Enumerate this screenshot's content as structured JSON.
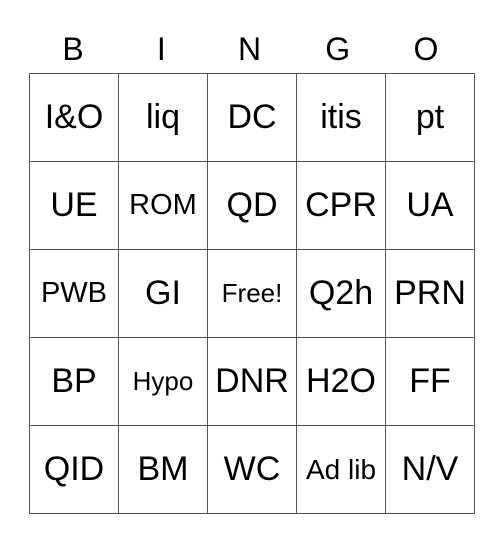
{
  "header": [
    "B",
    "I",
    "N",
    "G",
    "O"
  ],
  "rows": [
    [
      {
        "t": "I&O",
        "s": "s1"
      },
      {
        "t": "liq",
        "s": "s1"
      },
      {
        "t": "DC",
        "s": "s1"
      },
      {
        "t": "itis",
        "s": "s1"
      },
      {
        "t": "pt",
        "s": "s1"
      }
    ],
    [
      {
        "t": "UE",
        "s": "s1"
      },
      {
        "t": "ROM",
        "s": "s2"
      },
      {
        "t": "QD",
        "s": "s1"
      },
      {
        "t": "CPR",
        "s": "s1"
      },
      {
        "t": "UA",
        "s": "s1"
      }
    ],
    [
      {
        "t": "PWB",
        "s": "s2"
      },
      {
        "t": "GI",
        "s": "s1"
      },
      {
        "t": "Free!",
        "s": "s3"
      },
      {
        "t": "Q2h",
        "s": "s1"
      },
      {
        "t": "PRN",
        "s": "s1"
      }
    ],
    [
      {
        "t": "BP",
        "s": "s1"
      },
      {
        "t": "Hypo",
        "s": "s3"
      },
      {
        "t": "DNR",
        "s": "s1"
      },
      {
        "t": "H2O",
        "s": "s1"
      },
      {
        "t": "FF",
        "s": "s1"
      }
    ],
    [
      {
        "t": "QID",
        "s": "s1"
      },
      {
        "t": "BM",
        "s": "s1"
      },
      {
        "t": "WC",
        "s": "s1"
      },
      {
        "t": "Ad lib",
        "s": "s4"
      },
      {
        "t": "N/V",
        "s": "s1"
      }
    ]
  ]
}
